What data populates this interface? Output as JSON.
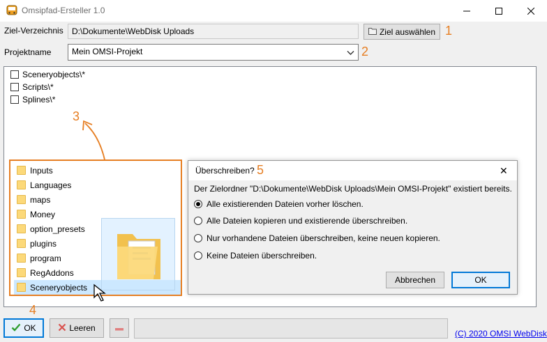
{
  "window": {
    "title": "Omsipfad-Ersteller 1.0",
    "controls": {
      "minimize": "—",
      "maximize": "☐",
      "close": "✕"
    }
  },
  "target_dir": {
    "label": "Ziel-Verzeichnis",
    "value": "D:\\Dokumente\\WebDisk Uploads",
    "button_label": "Ziel auswählen",
    "callout": "1"
  },
  "project": {
    "label": "Projektname",
    "value": "Mein OMSI-Projekt",
    "callout": "2"
  },
  "checklist": {
    "items": [
      {
        "label": "Sceneryobjects\\*",
        "checked": false
      },
      {
        "label": "Scripts\\*",
        "checked": false
      },
      {
        "label": "Splines\\*",
        "checked": false
      }
    ],
    "callout": "3"
  },
  "folders": {
    "items": [
      "Inputs",
      "Languages",
      "maps",
      "Money",
      "option_presets",
      "plugins",
      "program",
      "RegAddons",
      "Sceneryobjects"
    ],
    "selected": "Sceneryobjects"
  },
  "dialog": {
    "title": "Überschreiben?",
    "callout": "5",
    "message": "Der Zielordner \"D:\\Dokumente\\WebDisk Uploads\\Mein OMSI-Projekt\" existiert bereits.",
    "options": [
      {
        "label": "Alle existierenden Dateien vorher löschen.",
        "selected": true
      },
      {
        "label": "Alle Dateien kopieren und existierende überschreiben.",
        "selected": false
      },
      {
        "label": "Nur vorhandene Dateien überschreiben, keine neuen kopieren.",
        "selected": false
      },
      {
        "label": "Keine Dateien überschreiben.",
        "selected": false
      }
    ],
    "cancel_label": "Abbrechen",
    "ok_label": "OK",
    "close_glyph": "✕"
  },
  "bottom": {
    "ok_label": "OK",
    "ok_callout": "4",
    "clear_label": "Leeren",
    "remove_glyph": "—",
    "copyright": "(C) 2020 OMSI WebDisk"
  },
  "colors": {
    "accent": "#e67e22",
    "focus": "#0078d7",
    "selection": "#cce8ff",
    "folder": "#fcd97a"
  },
  "icons": [
    "bus-icon",
    "folder-icon",
    "checkmark-icon",
    "x-icon",
    "minus-icon",
    "chevron-down-icon",
    "cursor-icon"
  ]
}
